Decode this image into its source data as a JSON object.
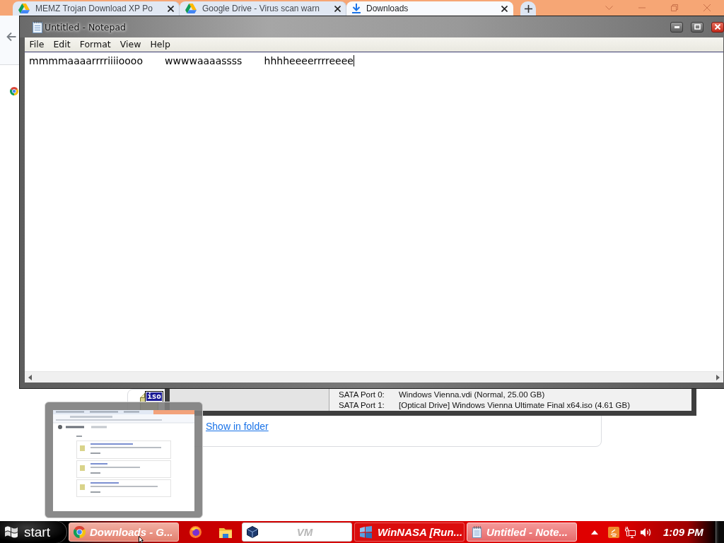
{
  "browser": {
    "tabs": [
      {
        "kind": "drive",
        "title": "MEMZ Trojan Download XP Po",
        "selected": false
      },
      {
        "kind": "drive",
        "title": "Google Drive - Virus scan warn",
        "selected": false
      },
      {
        "kind": "download",
        "title": "Downloads",
        "selected": true
      }
    ],
    "download": {
      "file_type": "iso",
      "link": "Show in folder"
    }
  },
  "notepad": {
    "title": "Untitled - Notepad",
    "menu": [
      "File",
      "Edit",
      "Format",
      "View",
      "Help"
    ],
    "text": "mmmmaaaarrrriiiioooo       wwwwaaaassss       hhhheeeerrrreeee"
  },
  "vm_details": {
    "rows": [
      {
        "label": "SATA Port 0:",
        "value": "Windows Vienna.vdi (Normal, 25.00 GB)"
      },
      {
        "label": "SATA Port 1:",
        "value": "[Optical Drive] Windows Vienna Ultimate Final x64.iso (4.61 GB)"
      }
    ]
  },
  "taskbar": {
    "start": "start",
    "items": [
      {
        "kind": "browser",
        "label": "Downloads - G...",
        "selected": false,
        "hovered": true
      },
      {
        "kind": "firefox",
        "selected": false,
        "hovered": false
      },
      {
        "kind": "folder",
        "selected": false,
        "hovered": false
      },
      {
        "kind": "vm_manager",
        "label": "VM",
        "selected": false,
        "hovered": false
      },
      {
        "kind": "vm",
        "label": "WinNASA [Run...",
        "selected": false,
        "hovered": false
      },
      {
        "kind": "editor",
        "label": "Untitled - Note...",
        "selected": true,
        "hovered": false
      }
    ],
    "clock": "1:09 PM"
  }
}
